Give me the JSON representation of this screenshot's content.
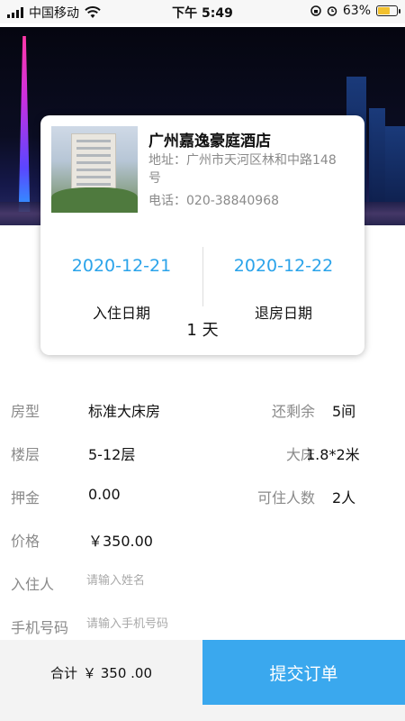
{
  "status_bar": {
    "carrier": "中国移动",
    "time": "下午 5:49",
    "battery": "63%",
    "battery_level": 0.63,
    "icons": [
      "signal-icon",
      "wifi-icon",
      "orientation-lock-icon",
      "alarm-icon",
      "battery-icon"
    ]
  },
  "hotel": {
    "name": "广州嘉逸豪庭酒店",
    "address": "地址：广州市天河区林和中路148号",
    "phone": "电话：020-38840968"
  },
  "dates": {
    "checkin_date": "2020-12-21",
    "checkin_label": "入住日期",
    "checkout_date": "2020-12-22",
    "checkout_label": "退房日期",
    "nights": "1 天"
  },
  "room": {
    "type_label": "房型",
    "type_value": "标准大床房",
    "remaining_label": "还剩余",
    "remaining_value": "5间",
    "floor_label": "楼层",
    "floor_value": "5-12层",
    "bed_label": "大床",
    "bed_value": "1.8*2米",
    "deposit_label": "押金",
    "deposit_value": "0.00",
    "capacity_label": "可住人数",
    "capacity_value": "2人",
    "price_label": "价格",
    "price_value": "￥350.00"
  },
  "form": {
    "guest_label": "入住人",
    "guest_placeholder": "请输入姓名",
    "phone_label": "手机号码",
    "phone_placeholder": "请输入手机号码"
  },
  "footer": {
    "total_label": "合计",
    "total_amount": "￥ 350 .00",
    "submit_label": "提交订单"
  },
  "colors": {
    "accent": "#2aa3ea",
    "submit_bg": "#3aa8ee",
    "muted": "#8a8a8a",
    "battery": "#f2c12e"
  }
}
